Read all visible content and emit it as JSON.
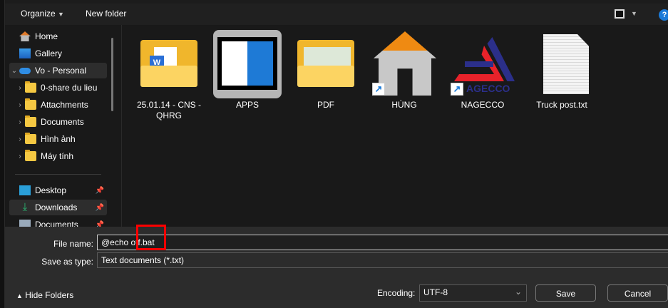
{
  "toolbar": {
    "organize": "Organize",
    "new_folder": "New folder",
    "help": "?"
  },
  "sidebar": {
    "items": [
      {
        "label": "Home"
      },
      {
        "label": "Gallery"
      },
      {
        "label": "Vo - Personal"
      },
      {
        "label": "0-share du lieu"
      },
      {
        "label": "Attachments"
      },
      {
        "label": "Documents"
      },
      {
        "label": "Hình ảnh"
      },
      {
        "label": "Máy tính"
      },
      {
        "label": "Desktop"
      },
      {
        "label": "Downloads"
      },
      {
        "label": "Documents"
      }
    ]
  },
  "files": [
    {
      "name": "25.01.14 - CNS - QHRG"
    },
    {
      "name": "APPS"
    },
    {
      "name": "PDF"
    },
    {
      "name": "HÙNG"
    },
    {
      "name": "NAGECCO",
      "logo_text": "AGECCO"
    },
    {
      "name": "Truck post.txt"
    }
  ],
  "form": {
    "file_name_label": "File name:",
    "file_name_value": "@echo off.bat",
    "save_type_label": "Save as type:",
    "save_type_value": "Text documents (*.txt)",
    "encoding_label": "Encoding:",
    "encoding_value": "UTF-8",
    "save": "Save",
    "cancel": "Cancel",
    "hide_folders": "Hide Folders"
  },
  "colors": {
    "highlight": "#ff0000",
    "accent": "#0078d4"
  }
}
